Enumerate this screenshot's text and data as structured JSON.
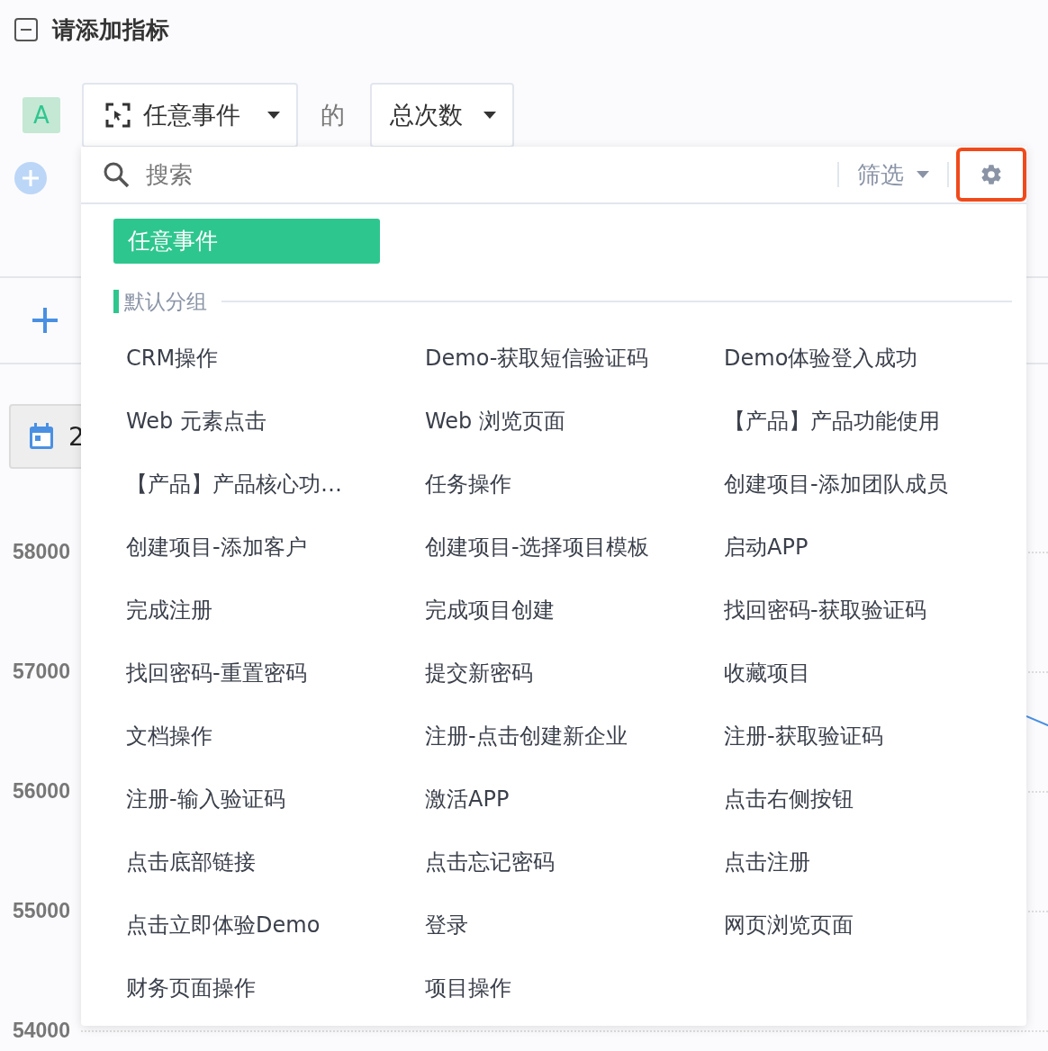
{
  "header": {
    "title": "请添加指标"
  },
  "metric": {
    "badge": "A",
    "event_select": "任意事件",
    "connector": "的",
    "aggregate_select": "总次数"
  },
  "date_button": {
    "label": "2"
  },
  "y_axis_labels": [
    "58000",
    "57000",
    "56000",
    "55000",
    "54000"
  ],
  "dropdown": {
    "search": {
      "placeholder": "搜索"
    },
    "filter": "筛选",
    "top_options": [
      {
        "label": "任意事件",
        "selected": true
      }
    ],
    "group": {
      "title": "默认分组",
      "items": [
        {
          "label": "CRM操作",
          "selected": false
        },
        {
          "label": "Demo-获取短信验证码",
          "selected": false
        },
        {
          "label": "Demo体验登入成功",
          "selected": false
        },
        {
          "label": "Web 元素点击",
          "selected": false
        },
        {
          "label": "Web 浏览页面",
          "selected": false
        },
        {
          "label": "【产品】产品功能使用",
          "selected": false
        },
        {
          "label": "【产品】产品核心功…",
          "selected": false
        },
        {
          "label": "任务操作",
          "selected": false
        },
        {
          "label": "创建项目-添加团队成员",
          "selected": false
        },
        {
          "label": "创建项目-添加客户",
          "selected": false
        },
        {
          "label": "创建项目-选择项目模板",
          "selected": false
        },
        {
          "label": "启动APP",
          "selected": false
        },
        {
          "label": "完成注册",
          "selected": false
        },
        {
          "label": "完成项目创建",
          "selected": false
        },
        {
          "label": "找回密码-获取验证码",
          "selected": false
        },
        {
          "label": "找回密码-重置密码",
          "selected": false
        },
        {
          "label": "提交新密码",
          "selected": false
        },
        {
          "label": "收藏项目",
          "selected": false
        },
        {
          "label": "文档操作",
          "selected": false
        },
        {
          "label": "注册-点击创建新企业",
          "selected": false
        },
        {
          "label": "注册-获取验证码",
          "selected": false
        },
        {
          "label": "注册-输入验证码",
          "selected": false
        },
        {
          "label": "激活APP",
          "selected": false
        },
        {
          "label": "点击右侧按钮",
          "selected": false
        },
        {
          "label": "点击底部链接",
          "selected": false
        },
        {
          "label": "点击忘记密码",
          "selected": false
        },
        {
          "label": "点击注册",
          "selected": false
        },
        {
          "label": "点击立即体验Demo",
          "selected": false
        },
        {
          "label": "登录",
          "selected": false
        },
        {
          "label": "网页浏览页面",
          "selected": false
        },
        {
          "label": "财务页面操作",
          "selected": false
        },
        {
          "label": "项目操作",
          "selected": false
        }
      ]
    }
  }
}
